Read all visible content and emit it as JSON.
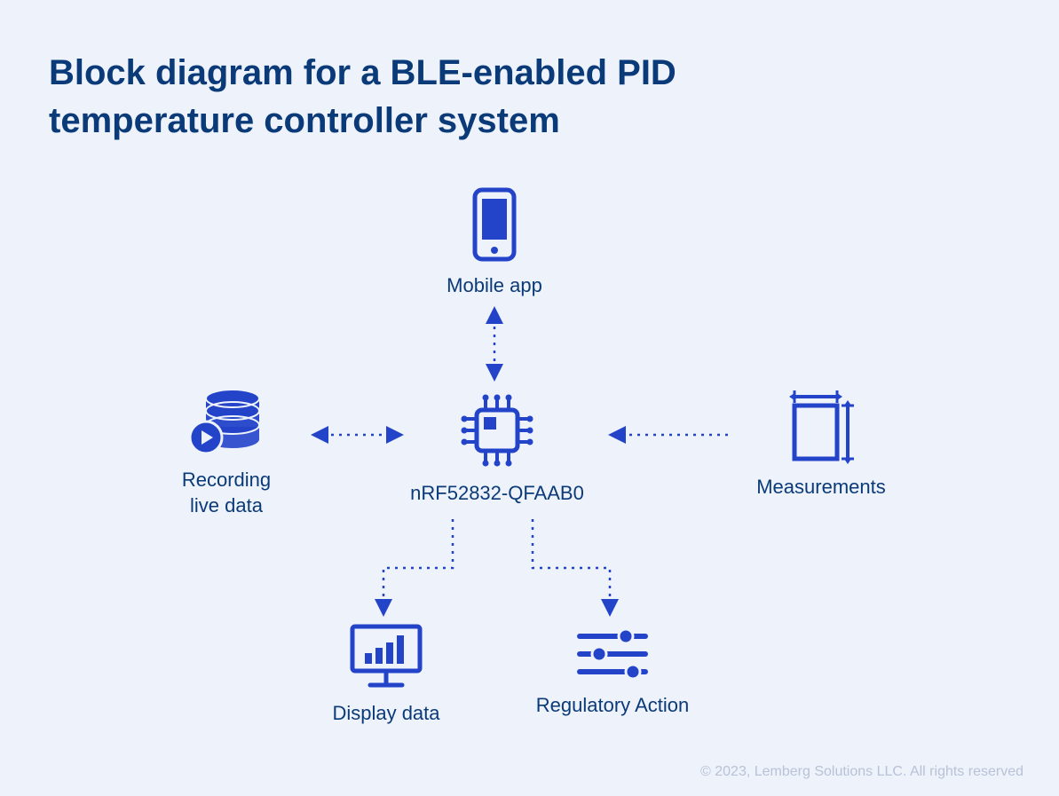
{
  "title": "Block diagram for a BLE-enabled PID temperature controller system",
  "nodes": {
    "mobile": {
      "label": "Mobile app"
    },
    "recording": {
      "label": "Recording\nlive data"
    },
    "chip": {
      "label": "nRF52832-QFAAB0"
    },
    "measurements": {
      "label": "Measurements"
    },
    "display": {
      "label": "Display data"
    },
    "regulatory": {
      "label": "Regulatory Action"
    }
  },
  "colors": {
    "primary": "#2343c9",
    "title": "#0b3a78"
  },
  "copyright": "© 2023, Lemberg Solutions LLC. All rights reserved"
}
